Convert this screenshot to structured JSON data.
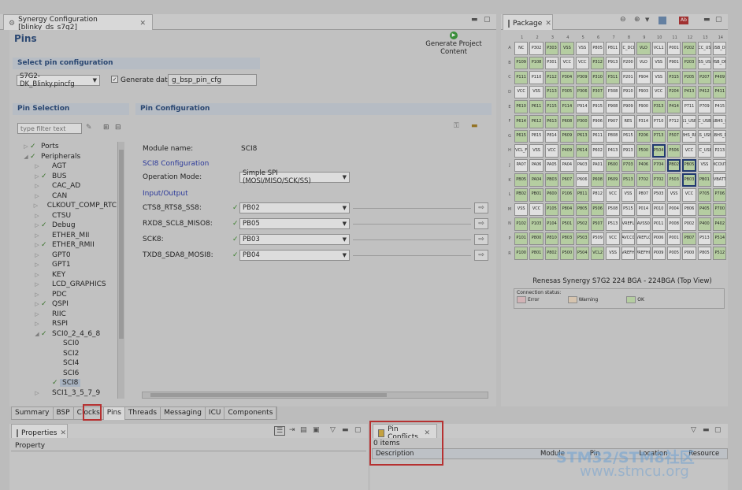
{
  "editor": {
    "tab_title": "Synergy Configuration [blinky_ds_s7g2]",
    "page_title": "Pins",
    "generate_label": "Generate Project Content"
  },
  "select_pin": {
    "header": "Select pin configuration",
    "file_value": "S7G2-DK_Blinky.pincfg",
    "generate_data_label": "Generate data:",
    "generate_data_value": "g_bsp_pin_cfg"
  },
  "pin_selection": {
    "header": "Pin Selection",
    "filter_placeholder": "type filter text",
    "items": [
      {
        "label": "Ports",
        "indent": 0,
        "tri": "▷",
        "check": true
      },
      {
        "label": "Peripherals",
        "indent": 0,
        "tri": "◢",
        "check": true
      },
      {
        "label": "AGT",
        "indent": 1,
        "tri": "▷",
        "check": false
      },
      {
        "label": "BUS",
        "indent": 1,
        "tri": "▷",
        "check": true
      },
      {
        "label": "CAC_AD",
        "indent": 1,
        "tri": "▷",
        "check": false
      },
      {
        "label": "CAN",
        "indent": 1,
        "tri": "▷",
        "check": false
      },
      {
        "label": "CLKOUT_COMP_RTC",
        "indent": 1,
        "tri": "▷",
        "check": false
      },
      {
        "label": "CTSU",
        "indent": 1,
        "tri": "▷",
        "check": false
      },
      {
        "label": "Debug",
        "indent": 1,
        "tri": "▷",
        "check": true
      },
      {
        "label": "ETHER_MII",
        "indent": 1,
        "tri": "▷",
        "check": false
      },
      {
        "label": "ETHER_RMII",
        "indent": 1,
        "tri": "▷",
        "check": true
      },
      {
        "label": "GPT0",
        "indent": 1,
        "tri": "▷",
        "check": false
      },
      {
        "label": "GPT1",
        "indent": 1,
        "tri": "▷",
        "check": false
      },
      {
        "label": "KEY",
        "indent": 1,
        "tri": "▷",
        "check": false
      },
      {
        "label": "LCD_GRAPHICS",
        "indent": 1,
        "tri": "▷",
        "check": false
      },
      {
        "label": "PDC",
        "indent": 1,
        "tri": "▷",
        "check": false
      },
      {
        "label": "QSPI",
        "indent": 1,
        "tri": "▷",
        "check": true
      },
      {
        "label": "RIIC",
        "indent": 1,
        "tri": "▷",
        "check": false
      },
      {
        "label": "RSPI",
        "indent": 1,
        "tri": "▷",
        "check": false
      },
      {
        "label": "SCI0_2_4_6_8",
        "indent": 1,
        "tri": "◢",
        "check": true
      },
      {
        "label": "SCI0",
        "indent": 2,
        "tri": "",
        "check": false
      },
      {
        "label": "SCI2",
        "indent": 2,
        "tri": "",
        "check": false
      },
      {
        "label": "SCI4",
        "indent": 2,
        "tri": "",
        "check": false
      },
      {
        "label": "SCI6",
        "indent": 2,
        "tri": "",
        "check": false
      },
      {
        "label": "SCI8",
        "indent": 2,
        "tri": "",
        "check": true,
        "selected": true
      },
      {
        "label": "SCI1_3_5_7_9",
        "indent": 1,
        "tri": "▷",
        "check": false
      }
    ]
  },
  "pin_config": {
    "header": "Pin Configuration",
    "module_label": "Module name:",
    "module_value": "SCI8",
    "group_title": "SCI8 Configuration",
    "op_mode_label": "Operation Mode:",
    "op_mode_value": "Simple SPI (MOSI/MISO/SCK/SS)",
    "io_title": "Input/Output",
    "pins": [
      {
        "label": "CTS8_RTS8_SS8:",
        "value": "PB02"
      },
      {
        "label": "RXD8_SCL8_MISO8:",
        "value": "PB05"
      },
      {
        "label": "SCK8:",
        "value": "PB03"
      },
      {
        "label": "TXD8_SDA8_MOSI8:",
        "value": "PB04"
      }
    ]
  },
  "bottom_tabs": [
    "Summary",
    "BSP",
    "Clocks",
    "Pins",
    "Threads",
    "Messaging",
    "ICU",
    "Components"
  ],
  "properties": {
    "tab": "Properties",
    "col": "Property"
  },
  "conflicts": {
    "tab": "Pin Conflicts",
    "count": "0 items",
    "columns": [
      "Description",
      "Module",
      "Pin",
      "Location",
      "Resource"
    ]
  },
  "package": {
    "tab": "Package",
    "caption": "Renesas Synergy S7G2 224 BGA - 224BGA (Top View)",
    "status_label": "Connection status:",
    "legend": [
      {
        "label": "Error",
        "color": "#e8c4c8"
      },
      {
        "label": "Warning",
        "color": "#ecd8c0"
      },
      {
        "label": "OK",
        "color": "#c6e2b0"
      }
    ],
    "cols": [
      "1",
      "2",
      "3",
      "4",
      "5",
      "6",
      "7",
      "8",
      "9",
      "10",
      "11",
      "12",
      "13",
      "14"
    ],
    "rows": [
      "A",
      "B",
      "C",
      "D",
      "E",
      "F",
      "G",
      "H",
      "J",
      "K",
      "L",
      "M",
      "N",
      "P",
      "R"
    ],
    "cells": [
      [
        "NC",
        "P302",
        "P303",
        "VSS",
        "VSS",
        "P805",
        "P811",
        "VCC_DCDC",
        "VLO",
        "VCL1",
        "P001",
        "P202",
        "VCC_USB",
        "USB_DP"
      ],
      [
        "P109",
        "P108",
        "P301",
        "VCC",
        "VCC",
        "P312",
        "P913",
        "P200",
        "VLO",
        "VSS",
        "P901",
        "P203",
        "VSS_USB",
        "USB_DM"
      ],
      [
        "P111",
        "P110",
        "P112",
        "P304",
        "P309",
        "P310",
        "P311",
        "P201",
        "P904",
        "VSS",
        "P315",
        "P205",
        "P207",
        "P409"
      ],
      [
        "VCC",
        "VSS",
        "P113",
        "P305",
        "P306",
        "P307",
        "P308",
        "P910",
        "P903",
        "VCC",
        "P204",
        "P413",
        "P412",
        "P411"
      ],
      [
        "P610",
        "P611",
        "P115",
        "P114",
        "P914",
        "P915",
        "P908",
        "P909",
        "P900",
        "P313",
        "P414",
        "P711",
        "P709",
        "P415"
      ],
      [
        "P614",
        "P612",
        "P613",
        "P608",
        "P300",
        "P906",
        "P907",
        "RES",
        "P314",
        "P710",
        "P712",
        "VSS1_USBHS",
        "VCC_USBHS",
        "USBHS_DP"
      ],
      [
        "P615",
        "P815",
        "P814",
        "P609",
        "P613",
        "P611",
        "P808",
        "P615",
        "P206",
        "P713",
        "P507",
        "USBHS_RREF",
        "AVSS_USBHS",
        "USBHS_DM"
      ],
      [
        "VCL_F",
        "VSS",
        "VCC",
        "P409",
        "P614",
        "P602",
        "P413",
        "P913",
        "P500",
        "P504",
        "P506",
        "VCC",
        "AVCC_USBHS",
        "P213"
      ],
      [
        "PA07",
        "PA06",
        "PA05",
        "PA04",
        "PA03",
        "PA01",
        "P600",
        "P703",
        "P406",
        "P704",
        "PB02",
        "PB05",
        "VSS",
        "XCOUT"
      ],
      [
        "PB05",
        "PA04",
        "PB03",
        "P607",
        "P606",
        "P608",
        "P609",
        "P513",
        "P702",
        "P702",
        "P503",
        "PB03",
        "PB01",
        "VBATT"
      ],
      [
        "PB02",
        "PB01",
        "P600",
        "P106",
        "P811",
        "P812",
        "VCC",
        "VSS",
        "P807",
        "P503",
        "VSS",
        "VCC",
        "P705",
        "P706"
      ],
      [
        "VSS",
        "VCC",
        "P105",
        "P804",
        "P805",
        "P506",
        "P508",
        "P515",
        "P014",
        "P010",
        "P004",
        "P806",
        "P405",
        "P700"
      ],
      [
        "P102",
        "P103",
        "P104",
        "P501",
        "P502",
        "P507",
        "P513",
        "VREFL",
        "AVSS0",
        "P011",
        "P008",
        "P002",
        "P400",
        "P402"
      ],
      [
        "P101",
        "P800",
        "P810",
        "P803",
        "P503",
        "P509",
        "VCC",
        "AVCC0",
        "VREFL0",
        "P006",
        "P001",
        "P807",
        "P513",
        "P514"
      ],
      [
        "P100",
        "P801",
        "P802",
        "P500",
        "P504",
        "VCL2",
        "VSS",
        "VREFH",
        "VREFH0",
        "P009",
        "P005",
        "P000",
        "P805",
        "P512"
      ]
    ],
    "used": [
      "A3",
      "A4",
      "A9",
      "A12",
      "B1",
      "B2",
      "B6",
      "B12",
      "C1",
      "C3",
      "C4",
      "C5",
      "C6",
      "C7",
      "C11",
      "C12",
      "C13",
      "C14",
      "D3",
      "D4",
      "D5",
      "D6",
      "D11",
      "D12",
      "D13",
      "D14",
      "E1",
      "E2",
      "E3",
      "E4",
      "E10",
      "E11",
      "F1",
      "F2",
      "F3",
      "F4",
      "F5",
      "G1",
      "G4",
      "G5",
      "G9",
      "G10",
      "G11",
      "H4",
      "H5",
      "H9",
      "H10",
      "H11",
      "J7",
      "J8",
      "J9",
      "J10",
      "J11",
      "J12",
      "K1",
      "K2",
      "K3",
      "K4",
      "K6",
      "K7",
      "K8",
      "K9",
      "K10",
      "K11",
      "K12",
      "K13",
      "L1",
      "L2",
      "L3",
      "L4",
      "L5",
      "L13",
      "L14",
      "M3",
      "M4",
      "M5",
      "M6",
      "M13",
      "M14",
      "N1",
      "N2",
      "N3",
      "N4",
      "N5",
      "N6",
      "N13",
      "N14",
      "P1",
      "P2",
      "P3",
      "P4",
      "P5",
      "P12",
      "P14",
      "R1",
      "R2",
      "R3",
      "R4",
      "R5",
      "R6",
      "R14"
    ],
    "selected": [
      "H10",
      "J11",
      "J12",
      "K12"
    ]
  },
  "watermark": {
    "line1": "STM32/STM8社区",
    "line2": "www.stmcu.org"
  }
}
